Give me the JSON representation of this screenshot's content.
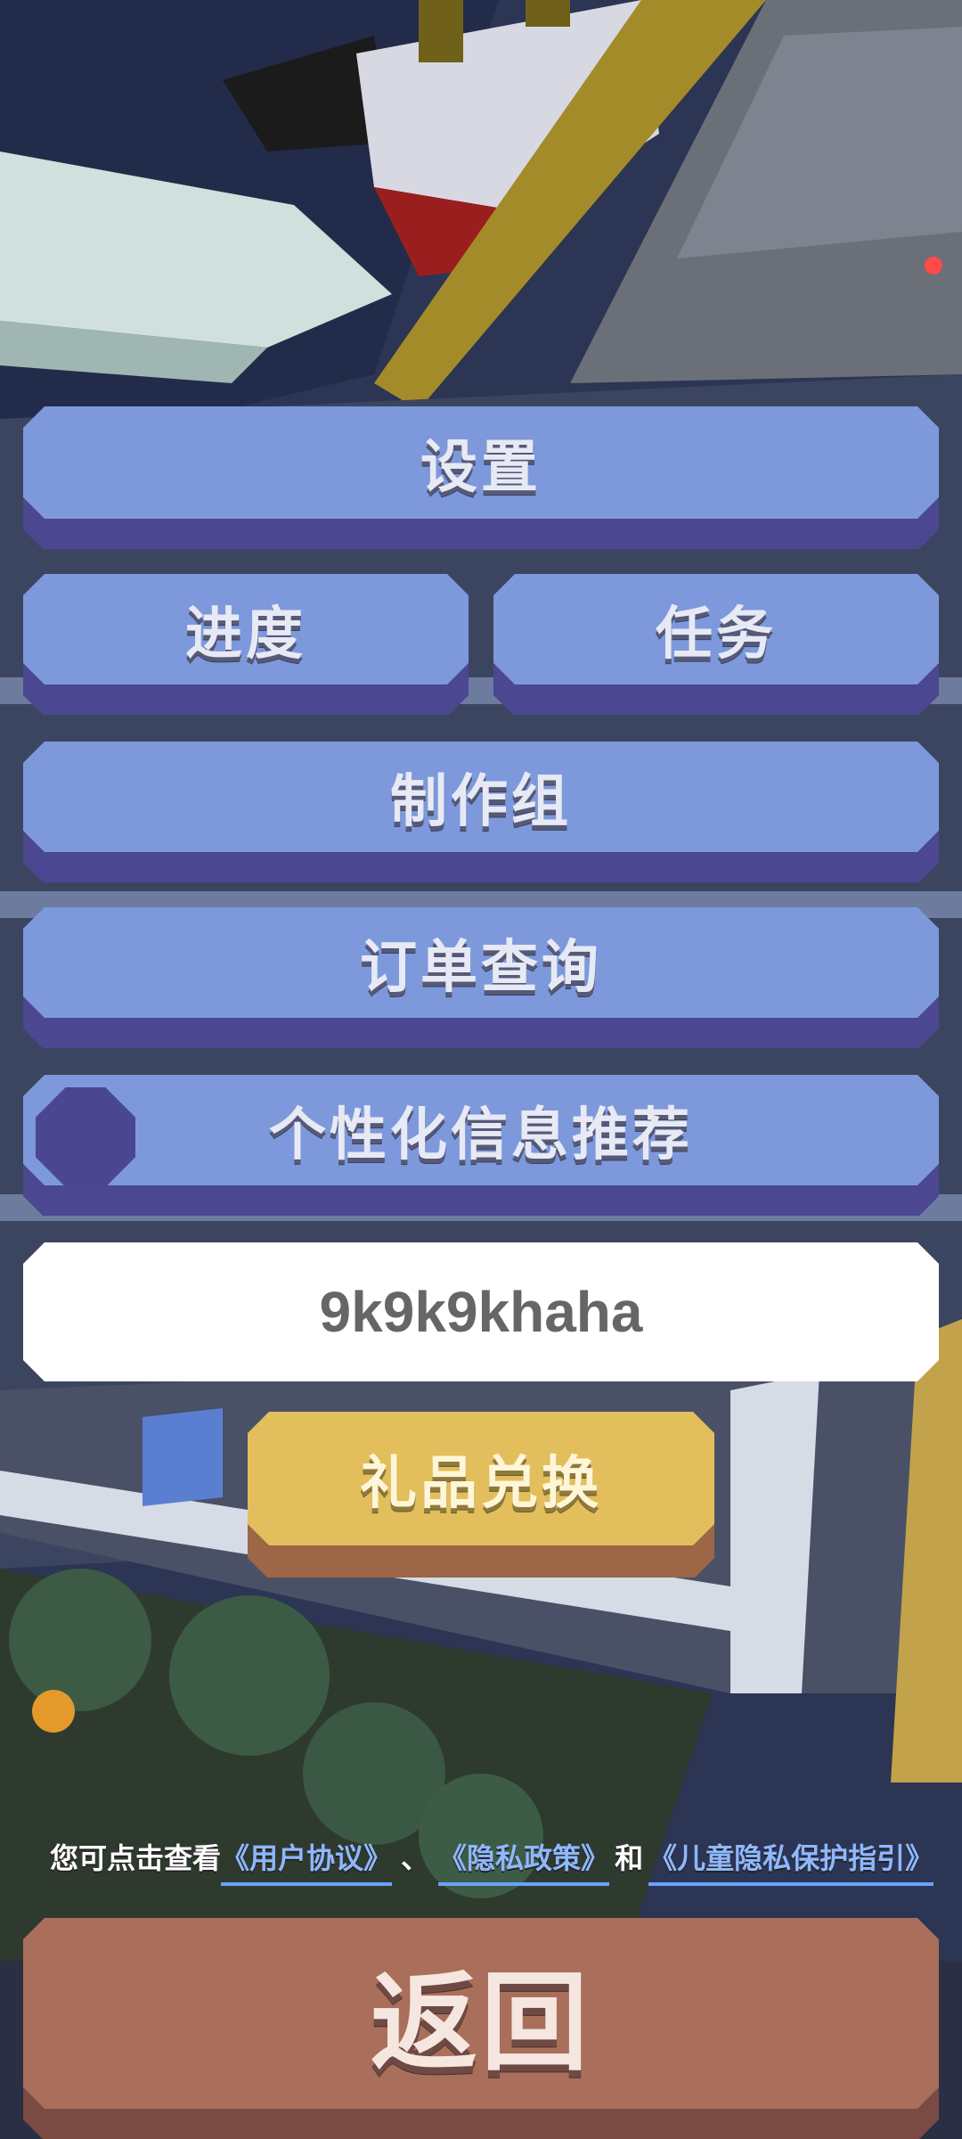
{
  "menu": {
    "settings_label": "设置",
    "progress_label": "进度",
    "tasks_label": "任务",
    "credits_label": "制作组",
    "orders_label": "订单查询",
    "personalized_label": "个性化信息推荐",
    "personalized_enabled": false
  },
  "player": {
    "name": "9k9k9khaha"
  },
  "gift": {
    "label": "礼品兑换"
  },
  "agreement": {
    "prefix": "您可点击查看",
    "user_agreement": "《用户协议》",
    "sep1": "、",
    "privacy_policy": "《隐私政策》",
    "sep2": "和",
    "child_privacy": "《儿童隐私保护指引》"
  },
  "back": {
    "label": "返回"
  },
  "colors": {
    "button_face": "#7d99dc",
    "button_shadow": "#4b4790",
    "gift_face": "#e2be5c",
    "gift_shadow": "#9c6647",
    "back_face": "#a96f5a",
    "back_shadow": "#7a4a44",
    "link": "#8fb7ff"
  }
}
